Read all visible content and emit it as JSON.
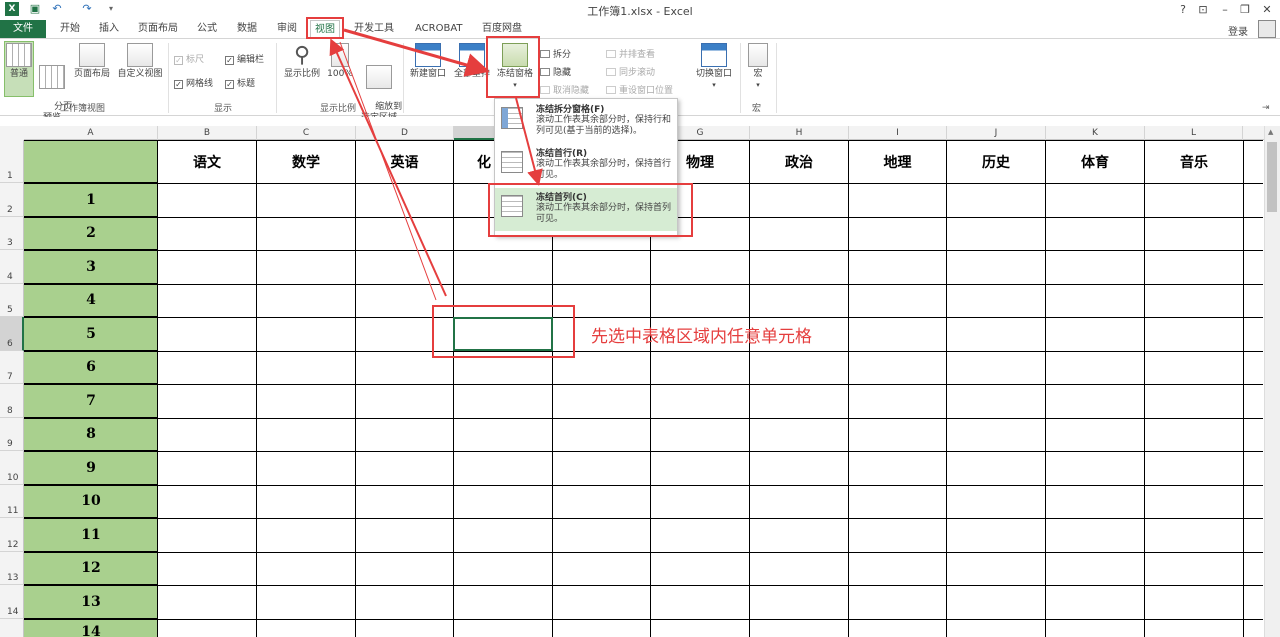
{
  "window": {
    "title": "工作簿1.xlsx - Excel",
    "logo": "X",
    "controls": [
      "?",
      "⊡",
      "–",
      "❐",
      "✕"
    ]
  },
  "tabs": {
    "file": "文件",
    "items": [
      "开始",
      "插入",
      "页面布局",
      "公式",
      "数据",
      "审阅",
      "视图",
      "开发工具",
      "ACROBAT",
      "百度网盘"
    ],
    "active": "视图",
    "login": "登录"
  },
  "ribbon": {
    "workbook_views": {
      "label": "工作簿视图",
      "normal": "普通",
      "page_break": "分页\n预览",
      "page_layout": "页面布局",
      "custom_views": "自定义视图"
    },
    "show": {
      "label": "显示",
      "ruler": "标尺",
      "formula_bar": "编辑栏",
      "gridlines": "网格线",
      "headings": "标题"
    },
    "zoom": {
      "label": "显示比例",
      "zoom": "显示比例",
      "hundred": "100%",
      "to_selection": "缩放到\n选定区域"
    },
    "window": {
      "new_window": "新建窗口",
      "arrange_all": "全部重排",
      "freeze_panes": "冻结窗格",
      "split": "拆分",
      "hide": "隐藏",
      "unhide": "取消隐藏",
      "side_by_side": "并排查看",
      "sync_scroll": "同步滚动",
      "reset_position": "重设窗口位置",
      "switch_windows": "切换窗口"
    },
    "macros": {
      "label": "宏",
      "macros": "宏"
    }
  },
  "freeze_menu": {
    "items": [
      {
        "title": "冻结拆分窗格(F)",
        "desc": "滚动工作表其余部分时，保持行和列可见(基于当前的选择)。"
      },
      {
        "title": "冻结首行(R)",
        "desc": "滚动工作表其余部分时，保持首行可见。"
      },
      {
        "title": "冻结首列(C)",
        "desc": "滚动工作表其余部分时，保持首列可见。"
      }
    ],
    "highlighted": 2
  },
  "sheet": {
    "columns": [
      "A",
      "B",
      "C",
      "D",
      "E",
      "F",
      "G",
      "H",
      "I",
      "J",
      "K",
      "L"
    ],
    "selected_column": "E",
    "rows": [
      "1",
      "2",
      "3",
      "4",
      "5",
      "6",
      "7",
      "8",
      "9",
      "10",
      "11",
      "12",
      "13",
      "14"
    ],
    "selected_row": "6",
    "header_row": [
      "",
      "语文",
      "数学",
      "英语",
      "化",
      "",
      "物理",
      "政治",
      "地理",
      "历史",
      "体育",
      "音乐"
    ],
    "col_a_values": [
      "1",
      "2",
      "3",
      "4",
      "5",
      "6",
      "7",
      "8",
      "9",
      "10",
      "11",
      "12",
      "13",
      "14"
    ],
    "colors": {
      "col_a_fill": "#a9d08e",
      "accent": "#217346",
      "annotation": "#e53e3e"
    }
  },
  "annotation": {
    "note": "先选中表格区域内任意单元格"
  }
}
